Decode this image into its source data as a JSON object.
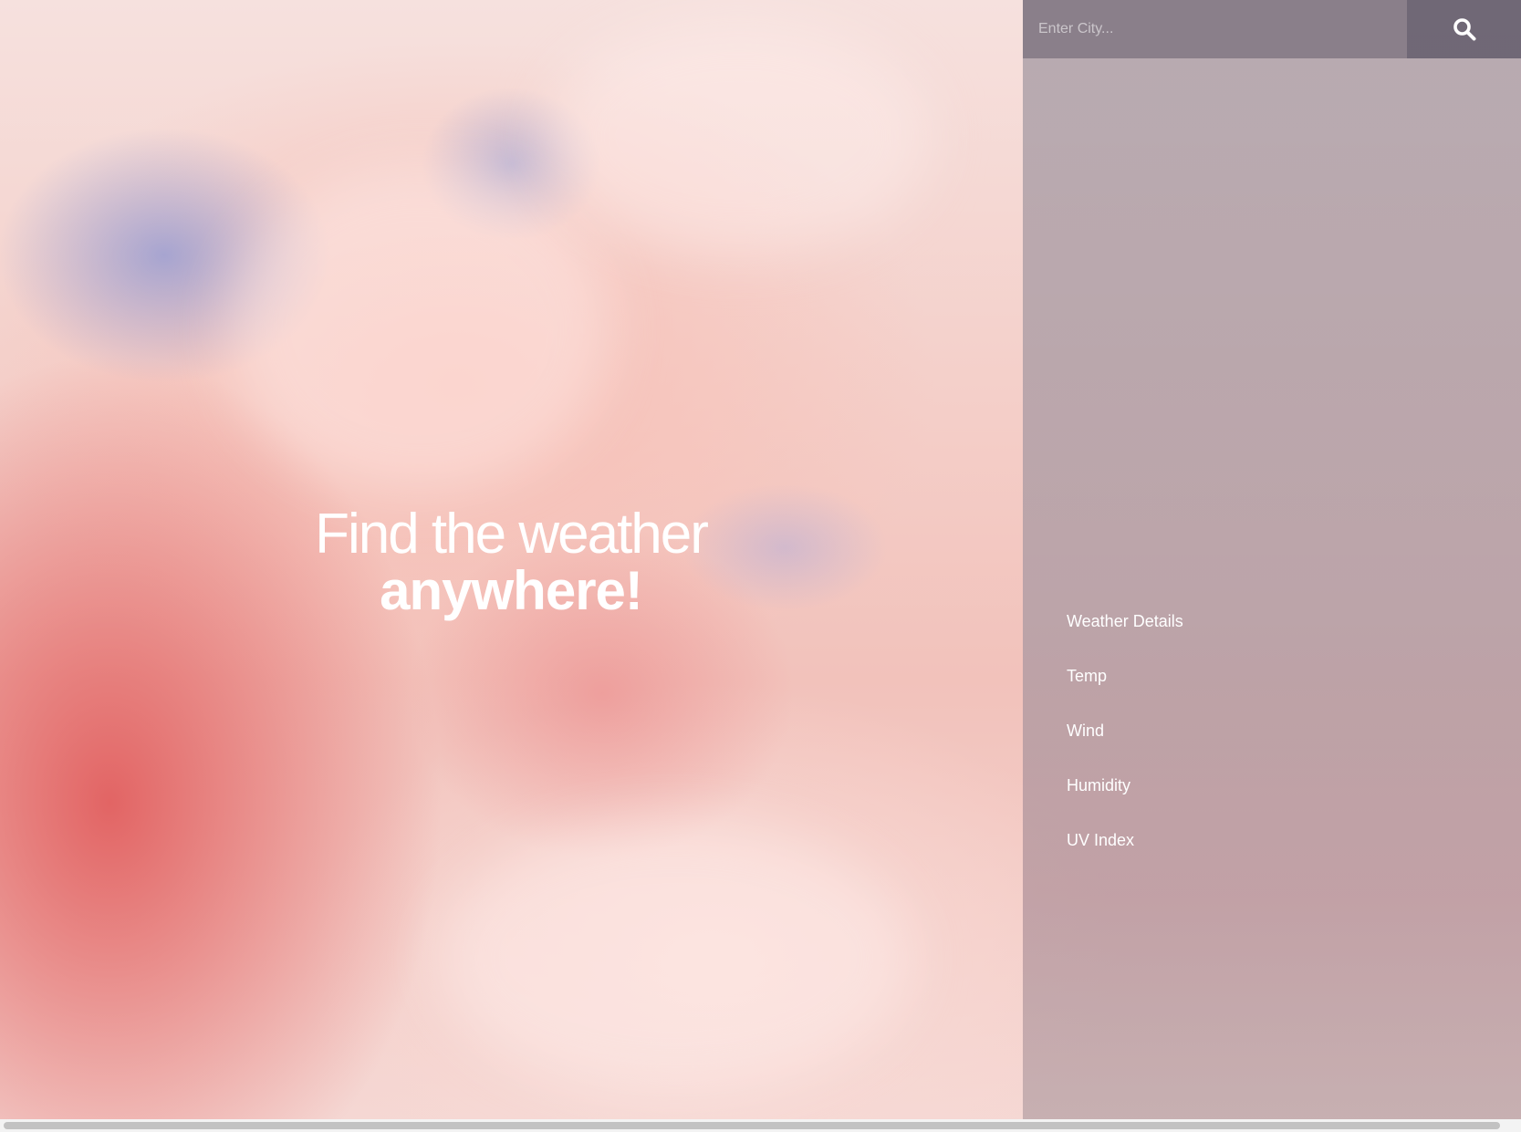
{
  "hero": {
    "line1": "Find the weather",
    "line2": "anywhere!"
  },
  "search": {
    "placeholder": "Enter City...",
    "button_icon": "search-icon"
  },
  "details": {
    "items": [
      "Weather Details",
      "Temp",
      "Wind",
      "Humidity",
      "UV Index"
    ]
  },
  "colors": {
    "panel_overlay": "#a0969f",
    "search_input_bg": "#6e6473",
    "search_button_bg": "#554e5f",
    "text": "#ffffff",
    "sky_pink": "#f4cfc9",
    "cloud_red": "#e15f5f"
  }
}
